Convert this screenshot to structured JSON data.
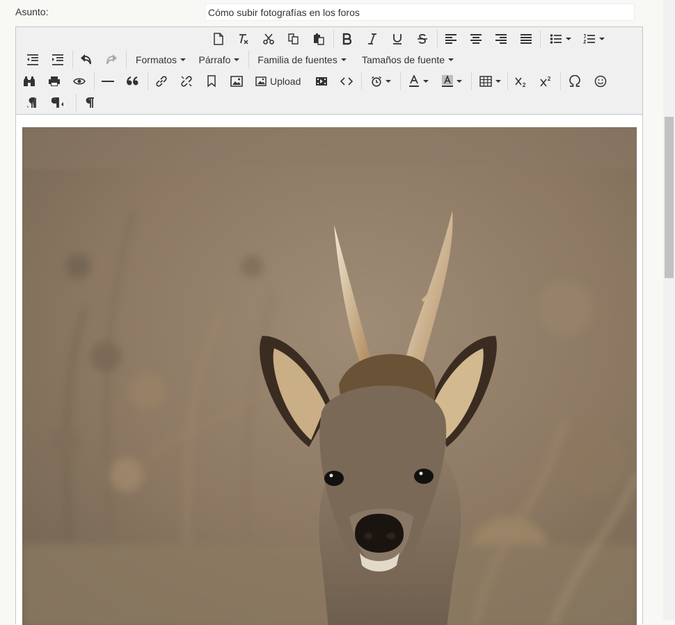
{
  "subject": {
    "label": "Asunto:",
    "value": "Cómo subir fotografías en los foros"
  },
  "toolbar": {
    "menus": {
      "formats": "Formatos",
      "paragraph": "Párrafo",
      "font_family": "Familia de fuentes",
      "font_size": "Tamaños de fuente"
    },
    "upload_label": "Upload",
    "icons": [
      "new-document-icon",
      "clear-format-icon",
      "cut-icon",
      "copy-icon",
      "paste-icon",
      "bold-icon",
      "italic-icon",
      "underline-icon",
      "strikethrough-icon",
      "align-left-icon",
      "align-center-icon",
      "align-right-icon",
      "justify-icon",
      "bullet-list-icon",
      "numbered-list-icon",
      "outdent-icon",
      "indent-icon",
      "undo-icon",
      "redo-icon",
      "find-replace-icon",
      "print-icon",
      "preview-icon",
      "horizontal-rule-icon",
      "blockquote-icon",
      "link-icon",
      "unlink-icon",
      "anchor-icon",
      "image-icon",
      "upload-image-icon",
      "media-icon",
      "code-icon",
      "insert-time-icon",
      "text-color-icon",
      "background-color-icon",
      "table-icon",
      "subscript-icon",
      "superscript-icon",
      "special-character-icon",
      "emoticons-icon",
      "ltr-icon",
      "rtl-icon",
      "visual-chars-icon"
    ]
  },
  "content": {
    "image_subject": "roe-deer-photo"
  },
  "colors": {
    "toolbar_bg": "#f0f0f0",
    "border": "#c5c5c5",
    "page_bg": "#f8f8f4"
  }
}
